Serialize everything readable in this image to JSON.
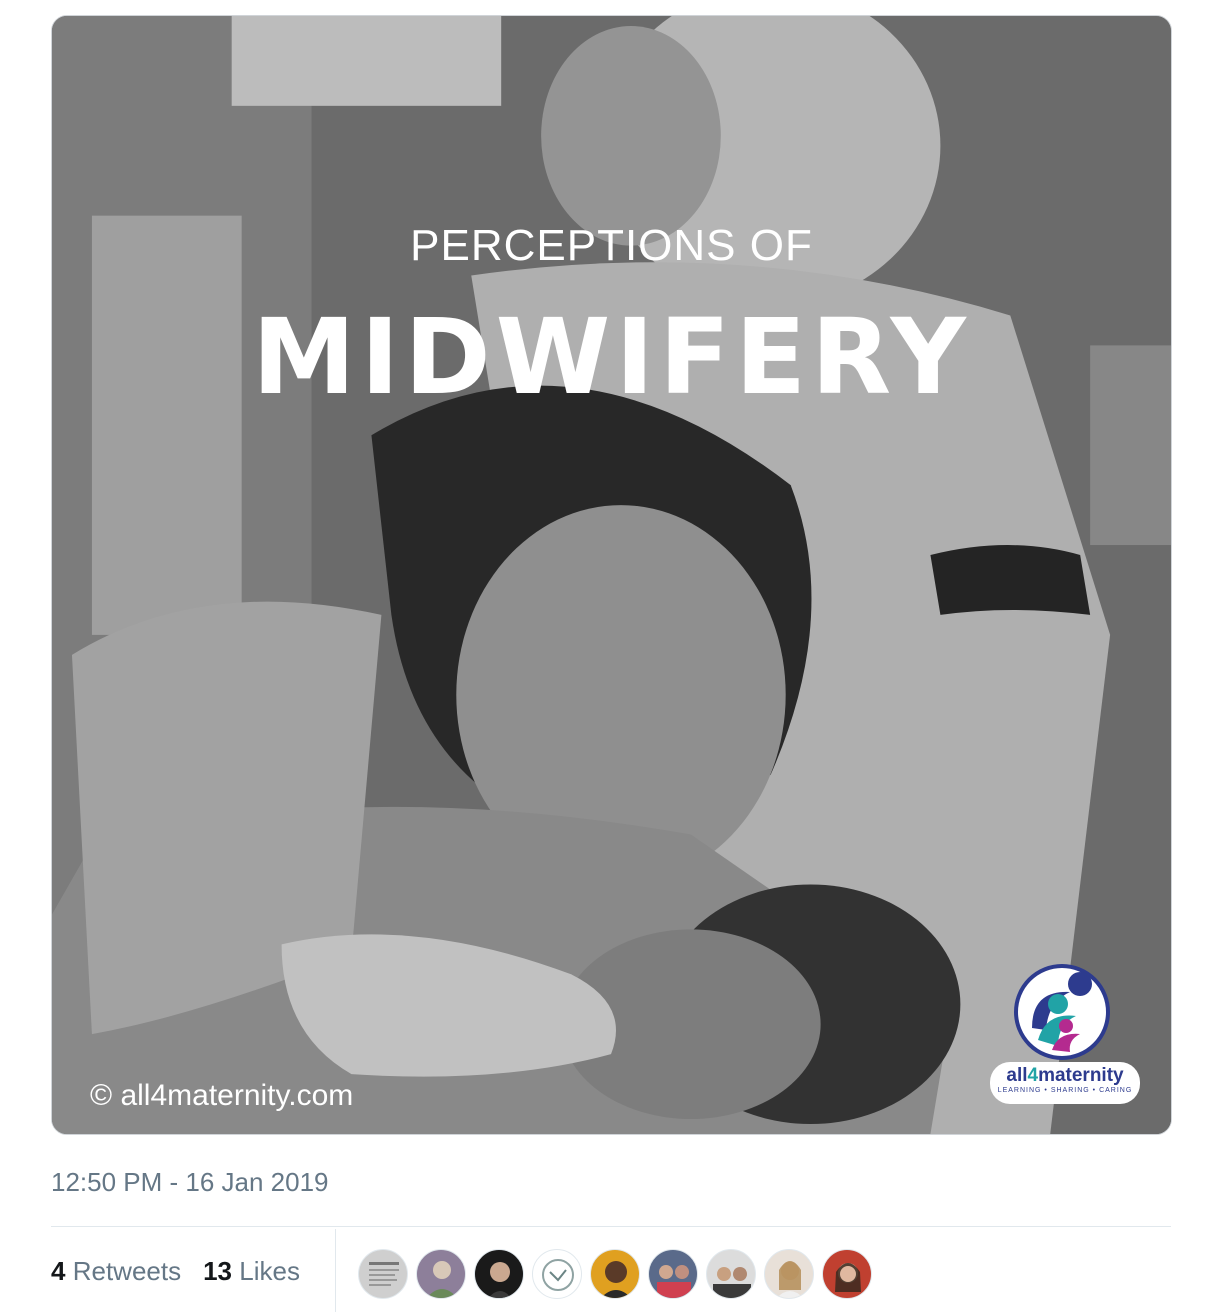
{
  "tweet": {
    "media": {
      "headline_small": "PERCEPTIONS OF",
      "headline_big": "MIDWIFERY",
      "copyright": "© all4maternity.com",
      "logo": {
        "name_prefix": "all",
        "name_number": "4",
        "name_suffix": "maternity",
        "tagline": "LEARNING • SHARING • CARING"
      }
    },
    "timestamp": "12:50 PM - 16 Jan 2019",
    "stats": {
      "retweets_count": "4",
      "retweets_label": "Retweets",
      "likes_count": "13",
      "likes_label": "Likes"
    },
    "likers": [
      {
        "icon": "avatar-document"
      },
      {
        "icon": "avatar-person"
      },
      {
        "icon": "avatar-person"
      },
      {
        "icon": "avatar-logo"
      },
      {
        "icon": "avatar-person"
      },
      {
        "icon": "avatar-group"
      },
      {
        "icon": "avatar-group"
      },
      {
        "icon": "avatar-person"
      },
      {
        "icon": "avatar-person"
      }
    ]
  }
}
